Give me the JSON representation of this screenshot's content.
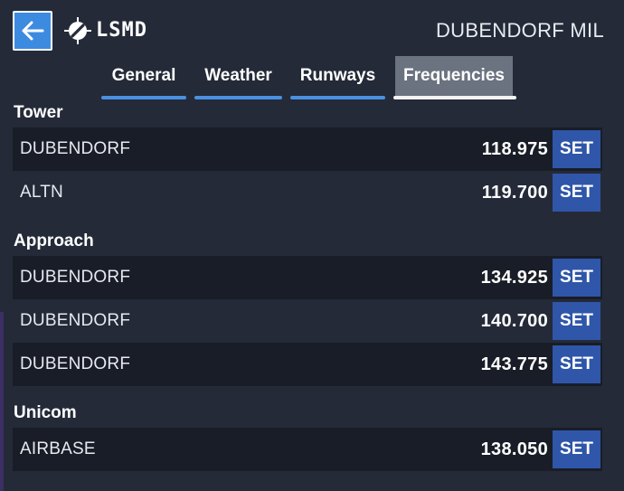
{
  "header": {
    "airport_code": "LSMD",
    "airport_name": "DUBENDORF MIL"
  },
  "tabs": [
    {
      "label": "General",
      "active": false
    },
    {
      "label": "Weather",
      "active": false
    },
    {
      "label": "Runways",
      "active": false
    },
    {
      "label": "Frequencies",
      "active": true
    }
  ],
  "sections": [
    {
      "title": "Tower",
      "rows": [
        {
          "name": "DUBENDORF",
          "frequency": "118.975",
          "button": "SET"
        },
        {
          "name": "ALTN",
          "frequency": "119.700",
          "button": "SET"
        }
      ]
    },
    {
      "title": "Approach",
      "rows": [
        {
          "name": "DUBENDORF",
          "frequency": "134.925",
          "button": "SET"
        },
        {
          "name": "DUBENDORF",
          "frequency": "140.700",
          "button": "SET"
        },
        {
          "name": "DUBENDORF",
          "frequency": "143.775",
          "button": "SET"
        }
      ]
    },
    {
      "title": "Unicom",
      "rows": [
        {
          "name": "AIRBASE",
          "frequency": "138.050",
          "button": "SET"
        }
      ]
    }
  ],
  "colors": {
    "background": "#242a38",
    "row_dark": "#191d27",
    "accent_blue": "#3d8be0",
    "set_button": "#2f56a8",
    "active_tab": "#6b7280"
  },
  "icons": {
    "back": "arrow-left-icon",
    "airport": "airport-icon"
  }
}
